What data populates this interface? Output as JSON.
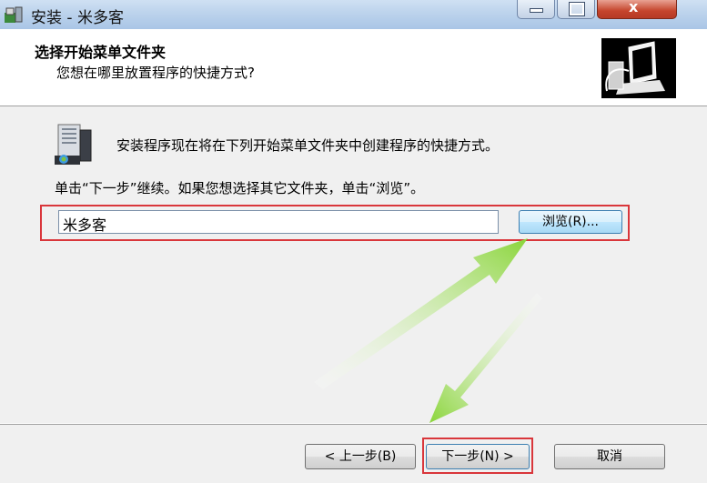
{
  "window": {
    "title": "安装 - 米多客",
    "close_label": "x"
  },
  "header": {
    "title": "选择开始菜单文件夹",
    "subtitle": "您想在哪里放置程序的快捷方式?"
  },
  "content": {
    "info_line1": "安装程序现在将在下列开始菜单文件夹中创建程序的快捷方式。",
    "info_line2": "单击“下一步”继续。如果您想选择其它文件夹，单击“浏览”。",
    "folder_value": "米多客",
    "browse_label": "浏览(R)..."
  },
  "footer": {
    "back_label": "< 上一步(B)",
    "next_label": "下一步(N) >",
    "cancel_label": "取消"
  },
  "colors": {
    "highlight": "#d9363b",
    "arrow": "#8ad53a"
  },
  "icons": {
    "app": "installer-icon",
    "folder": "program-folder-icon",
    "header": "computer-setup-icon"
  }
}
